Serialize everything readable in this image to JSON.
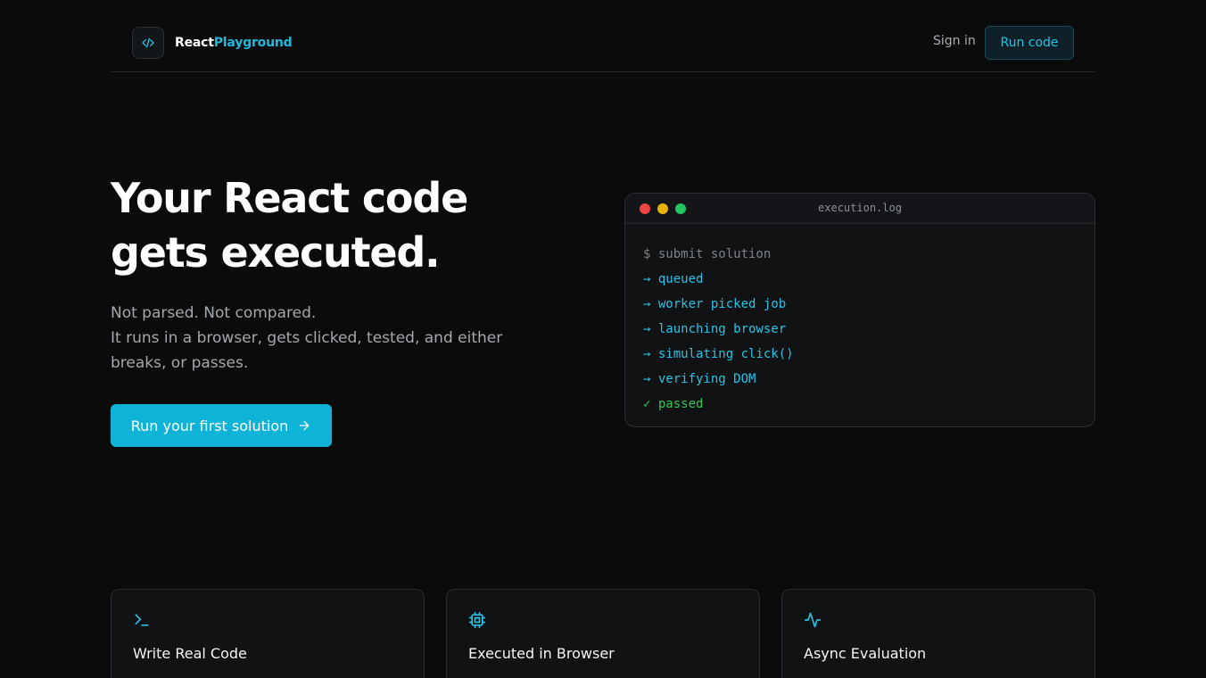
{
  "header": {
    "brand_part1": "React",
    "brand_part2": "Playground",
    "logo_icon": "code-icon",
    "signin_label": "Sign in",
    "runcode_label": "Run code"
  },
  "hero": {
    "title_line1": "Your React code",
    "title_line2": "gets executed.",
    "subtitle_line1": "Not parsed. Not compared.",
    "subtitle_line2": "It runs in a browser, gets clicked, tested, and either",
    "subtitle_line3": "breaks, or passes.",
    "cta_label": "Run your first solution",
    "cta_icon": "arrow-right-icon"
  },
  "terminal": {
    "title": "execution.log",
    "lines": [
      "$ submit solution",
      "→ queued",
      "→ worker picked job",
      "→ launching browser",
      "→ simulating click()",
      "→ verifying DOM",
      "✓ passed"
    ]
  },
  "features": [
    {
      "icon": "terminal-icon",
      "title": "Write Real Code",
      "desc": ""
    },
    {
      "icon": "cpu-icon",
      "title": "Executed in Browser",
      "desc": ""
    },
    {
      "icon": "activity-icon",
      "title": "Async Evaluation",
      "desc": ""
    }
  ],
  "colors": {
    "accent": "#0fb3d8",
    "background": "#0b0b0c",
    "success": "#34c759"
  }
}
